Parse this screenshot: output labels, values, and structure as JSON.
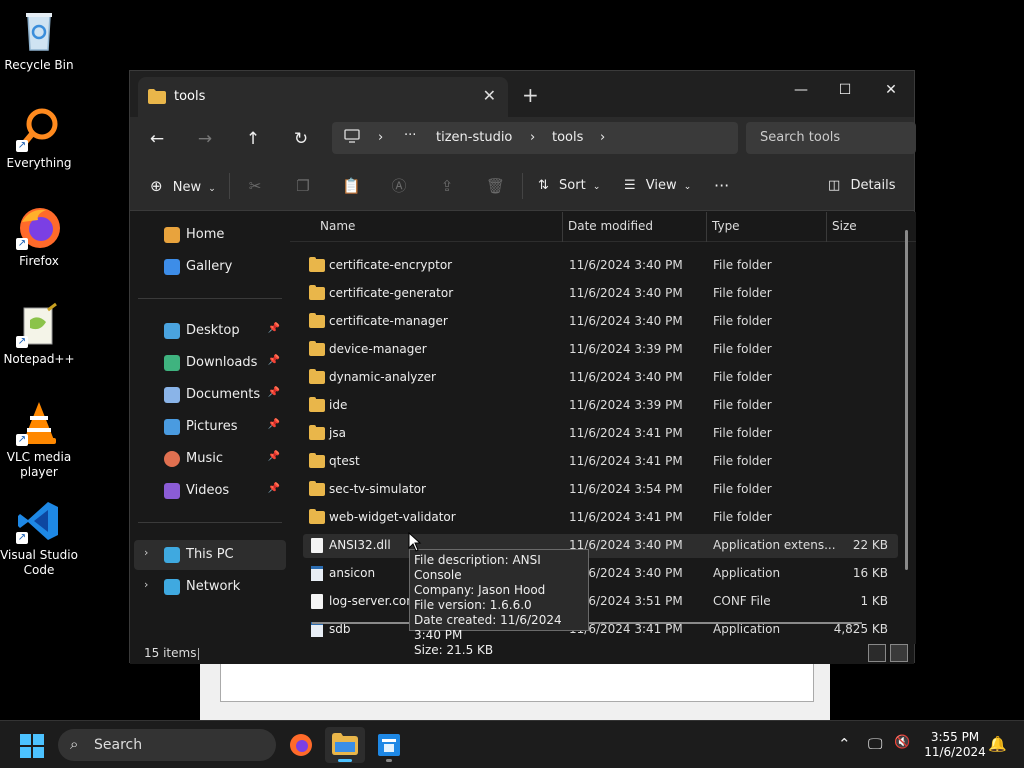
{
  "desktop": {
    "icons": [
      {
        "label": "Recycle Bin"
      },
      {
        "label": "Everything"
      },
      {
        "label": "Firefox"
      },
      {
        "label": "Notepad++"
      },
      {
        "label": "VLC media player"
      },
      {
        "label": "Visual Studio Code"
      }
    ]
  },
  "window": {
    "tab_title": "tools",
    "tab_close": "✕",
    "new_tab": "+",
    "controls": {
      "minimize": "—",
      "maximize": "☐",
      "close": "✕"
    },
    "breadcrumb": [
      "tizen-studio",
      "tools"
    ],
    "breadcrumb_more": "···",
    "search_placeholder": "Search tools",
    "toolbar": {
      "new_label": "New",
      "sort_label": "Sort",
      "view_label": "View",
      "more": "···",
      "details_label": "Details"
    }
  },
  "sidebar": {
    "items": [
      {
        "label": "Home",
        "color": "#e8a33d"
      },
      {
        "label": "Gallery",
        "color": "#3d8de8"
      },
      {
        "label": "Desktop",
        "color": "#4aa3df",
        "pinned": true
      },
      {
        "label": "Downloads",
        "color": "#3fb37f",
        "pinned": true
      },
      {
        "label": "Documents",
        "color": "#8ab4e8",
        "pinned": true
      },
      {
        "label": "Pictures",
        "color": "#4a9be0",
        "pinned": true
      },
      {
        "label": "Music",
        "color": "#e07050",
        "pinned": true
      },
      {
        "label": "Videos",
        "color": "#8b5cd6",
        "pinned": true
      },
      {
        "label": "This PC",
        "color": "#3fa9e0"
      },
      {
        "label": "Network",
        "color": "#3fa9e0"
      }
    ]
  },
  "columns": {
    "name": "Name",
    "date": "Date modified",
    "type": "Type",
    "size": "Size"
  },
  "files": [
    {
      "name": "certificate-encryptor",
      "date": "11/6/2024 3:40 PM",
      "type": "File folder",
      "size": "",
      "kind": "folder"
    },
    {
      "name": "certificate-generator",
      "date": "11/6/2024 3:40 PM",
      "type": "File folder",
      "size": "",
      "kind": "folder"
    },
    {
      "name": "certificate-manager",
      "date": "11/6/2024 3:40 PM",
      "type": "File folder",
      "size": "",
      "kind": "folder"
    },
    {
      "name": "device-manager",
      "date": "11/6/2024 3:39 PM",
      "type": "File folder",
      "size": "",
      "kind": "folder"
    },
    {
      "name": "dynamic-analyzer",
      "date": "11/6/2024 3:40 PM",
      "type": "File folder",
      "size": "",
      "kind": "folder"
    },
    {
      "name": "ide",
      "date": "11/6/2024 3:39 PM",
      "type": "File folder",
      "size": "",
      "kind": "folder"
    },
    {
      "name": "jsa",
      "date": "11/6/2024 3:41 PM",
      "type": "File folder",
      "size": "",
      "kind": "folder"
    },
    {
      "name": "qtest",
      "date": "11/6/2024 3:41 PM",
      "type": "File folder",
      "size": "",
      "kind": "folder"
    },
    {
      "name": "sec-tv-simulator",
      "date": "11/6/2024 3:54 PM",
      "type": "File folder",
      "size": "",
      "kind": "folder"
    },
    {
      "name": "web-widget-validator",
      "date": "11/6/2024 3:41 PM",
      "type": "File folder",
      "size": "",
      "kind": "folder"
    },
    {
      "name": "ANSI32.dll",
      "date": "11/6/2024 3:40 PM",
      "type": "Application extens...",
      "size": "22 KB",
      "kind": "file"
    },
    {
      "name": "ansicon",
      "date": "11/6/2024 3:40 PM",
      "type": "Application",
      "size": "16 KB",
      "kind": "app"
    },
    {
      "name": "log-server.conf",
      "date": "11/6/2024 3:51 PM",
      "type": "CONF File",
      "size": "1 KB",
      "kind": "file"
    },
    {
      "name": "sdb",
      "date": "11/6/2024 3:41 PM",
      "type": "Application",
      "size": "4,825 KB",
      "kind": "app"
    }
  ],
  "status": {
    "item_count": "15 items"
  },
  "tooltip": {
    "lines": [
      "File description: ANSI Console",
      "Company: Jason Hood",
      "File version: 1.6.6.0",
      "Date created: 11/6/2024 3:40 PM",
      "Size: 21.5 KB"
    ]
  },
  "taskbar": {
    "search_label": "Search",
    "time": "3:55 PM",
    "date": "11/6/2024"
  },
  "colors": {
    "accent": "#4cc2ff",
    "folder": "#e9b64a"
  }
}
